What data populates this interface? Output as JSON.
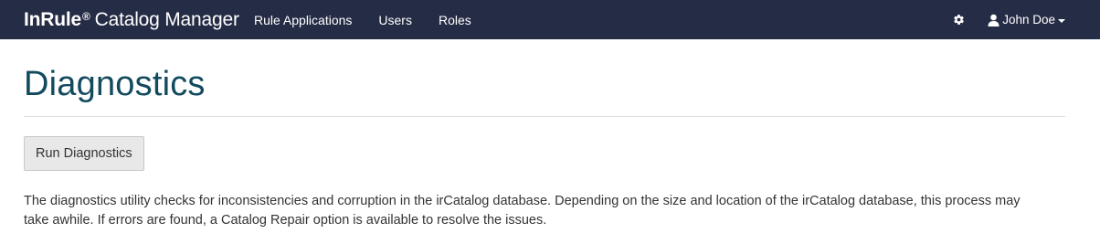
{
  "navbar": {
    "brand_strong": "InRule",
    "brand_reg": "®",
    "brand_rest": "Catalog Manager",
    "links": [
      {
        "label": "Rule Applications"
      },
      {
        "label": "Users"
      },
      {
        "label": "Roles"
      }
    ],
    "settings_icon": "gear-icon",
    "user": {
      "icon": "user-icon",
      "name": "John Doe"
    }
  },
  "page": {
    "title": "Diagnostics",
    "run_button_label": "Run Diagnostics",
    "description": "The diagnostics utility checks for inconsistencies and corruption in the irCatalog database. Depending on the size and location of the irCatalog database, this process may take awhile. If errors are found, a Catalog Repair option is available to resolve the issues."
  },
  "colors": {
    "navbar_bg": "#252c45",
    "title": "#124a5e",
    "button_bg": "#e8e8e8"
  }
}
